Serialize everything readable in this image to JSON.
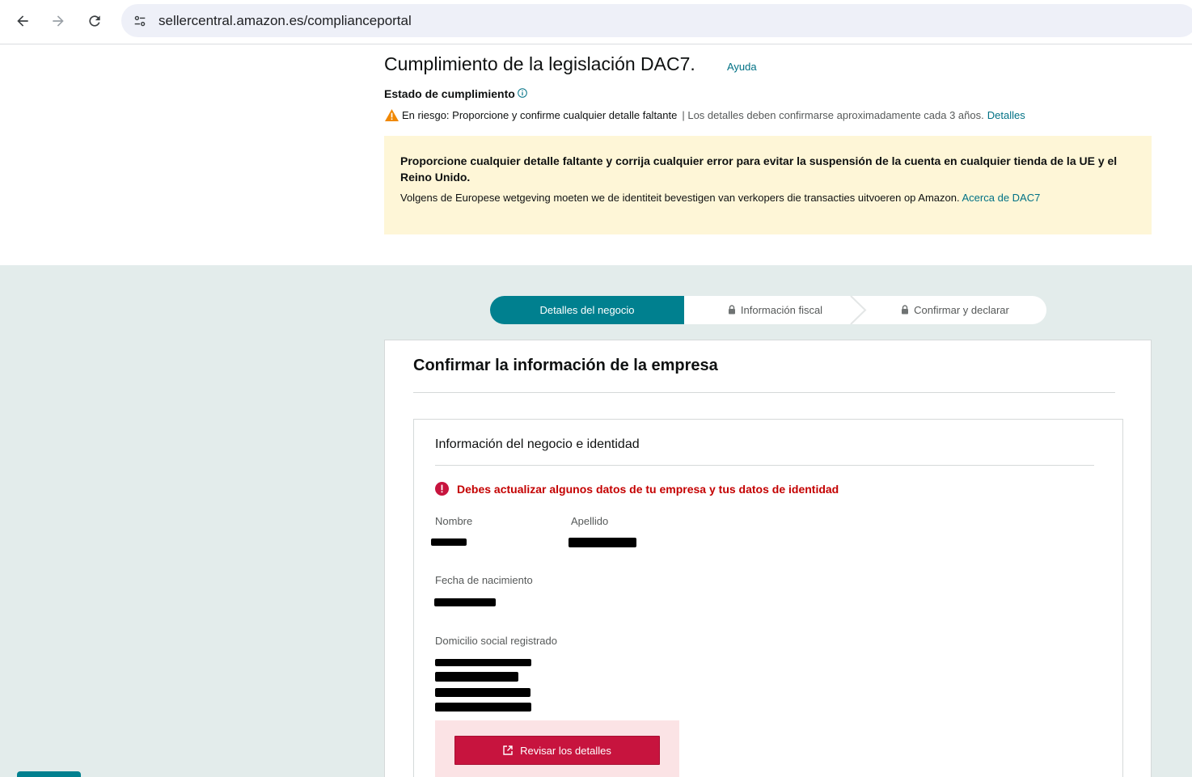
{
  "browser": {
    "url": "sellercentral.amazon.es/complianceportal",
    "back_icon": "back-arrow-icon",
    "forward_icon": "forward-arrow-icon",
    "reload_icon": "reload-icon",
    "site_info_icon": "site-settings-icon"
  },
  "header": {
    "title": "Cumplimiento de la legislación DAC7.",
    "help_link": "Ayuda"
  },
  "compliance_status": {
    "label": "Estado de cumplimiento",
    "risk_text": "En riesgo: Proporcione y confirme cualquier detalle faltante",
    "note": "| Los detalles deben confirmarse aproximadamente cada 3 años.",
    "details_link": "Detalles"
  },
  "alert": {
    "bold_text": "Proporcione cualquier detalle faltante y corrija cualquier error para evitar la suspensión de la cuenta en cualquier tienda de la UE y el Reino Unido.",
    "body_text": "Volgens de Europese wetgeving moeten we de identiteit bevestigen van verkopers die transacties uitvoeren op Amazon.",
    "link": "Acerca de DAC7",
    "background": "#fef6d7"
  },
  "stepper": {
    "steps": [
      {
        "label": "Detalles del negocio",
        "state": "active"
      },
      {
        "label": "Información fiscal",
        "state": "locked"
      },
      {
        "label": "Confirmar y declarar",
        "state": "locked"
      }
    ],
    "accent": "#00808f"
  },
  "card": {
    "title": "Confirmar la información de la empresa",
    "section": {
      "title": "Información del negocio e identidad",
      "error": "Debes actualizar algunos datos de tu empresa y tus datos de identidad",
      "fields": {
        "first_name_label": "Nombre",
        "last_name_label": "Apellido",
        "dob_label": "Fecha de nacimiento",
        "address_label": "Domicilio social registrado"
      },
      "review_button": "Revisar los detalles"
    }
  },
  "colors": {
    "link": "#007185",
    "error": "#c40000",
    "button": "#c7143e",
    "page_bg_lower": "#e3eceb"
  }
}
